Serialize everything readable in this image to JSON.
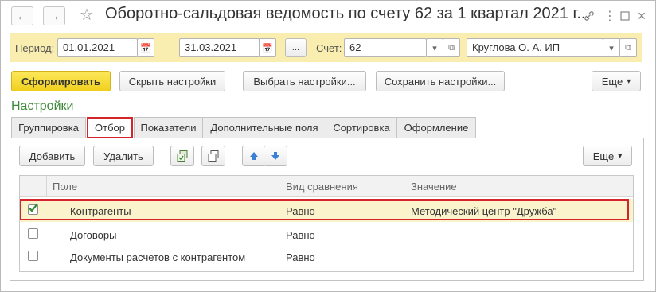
{
  "window": {
    "title": "Оборотно-сальдовая ведомость по счету 62 за 1 квартал 2021 г...",
    "back_icon": "arrow-left-icon",
    "forward_icon": "arrow-right-icon",
    "favorite_icon": "star-icon",
    "link_icon": "link-icon",
    "more_icon": "vertical-dots-icon",
    "maximize_icon": "maximize-icon",
    "close_icon": "close-icon"
  },
  "params": {
    "period_label": "Период:",
    "date_from": "01.01.2021",
    "dash": "–",
    "date_to": "31.03.2021",
    "period_button": "...",
    "account_label": "Счет:",
    "account_value": "62",
    "organization_value": "Круглова О. А. ИП"
  },
  "toolbar": {
    "generate": "Сформировать",
    "hide_settings": "Скрыть настройки",
    "choose_settings": "Выбрать настройки...",
    "save_settings": "Сохранить настройки...",
    "more": "Еще"
  },
  "settings": {
    "title": "Настройки",
    "tabs": [
      {
        "label": "Группировка",
        "active": false
      },
      {
        "label": "Отбор",
        "active": true
      },
      {
        "label": "Показатели",
        "active": false
      },
      {
        "label": "Дополнительные поля",
        "active": false
      },
      {
        "label": "Сортировка",
        "active": false
      },
      {
        "label": "Оформление",
        "active": false
      }
    ]
  },
  "filter_toolbar": {
    "add": "Добавить",
    "delete": "Удалить",
    "more": "Еще",
    "copy_icon": "copy-icon",
    "group_icon": "group-icon",
    "up_icon": "arrow-up-icon",
    "down_icon": "arrow-down-icon"
  },
  "table": {
    "columns": [
      "Поле",
      "Вид сравнения",
      "Значение"
    ],
    "rows": [
      {
        "checked": true,
        "field": "Контрагенты",
        "comparison": "Равно",
        "value": "Методический центр \"Дружба\""
      },
      {
        "checked": false,
        "field": "Договоры",
        "comparison": "Равно",
        "value": ""
      },
      {
        "checked": false,
        "field": "Документы расчетов с контрагентом",
        "comparison": "Равно",
        "value": ""
      }
    ]
  },
  "colors": {
    "accent_green": "#3d8a3a",
    "highlight_red": "#d4262a",
    "param_band": "#f9eeb0",
    "primary_button": "#f1cf1d",
    "selected_row": "#faf3cc"
  }
}
